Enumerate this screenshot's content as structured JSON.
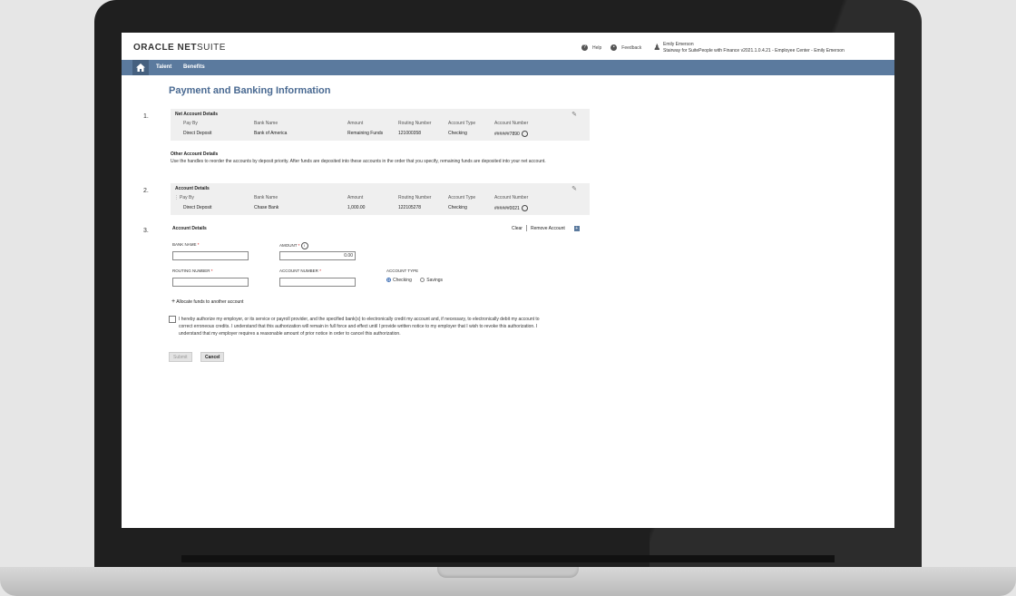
{
  "header": {
    "logo_brand": "ORACLE",
    "logo_net": "NET",
    "logo_suite": "SUITE",
    "help_label": "Help",
    "feedback_label": "Feedback",
    "user_name": "Emily Emerson",
    "user_context": "Stairway for SuitePeople with Finance v2021.1.0.4.21 - Employee Center - Emily Emerson"
  },
  "nav": {
    "items": [
      "Talent",
      "Benefits"
    ]
  },
  "page": {
    "title": "Payment and Banking Information"
  },
  "columns": [
    "Pay By",
    "Bank Name",
    "Amount",
    "Routing Number",
    "Account Type",
    "Account Number"
  ],
  "net_account": {
    "step": "1.",
    "title": "Net Account Details",
    "row": [
      "Direct Deposit",
      "Bank of America",
      "Remaining Funds",
      "121000358",
      "Checking",
      "######7890"
    ]
  },
  "other_account": {
    "title": "Other Account Details",
    "description": "Use the handles    to reorder the accounts by deposit priority. After funds are deposited into these accounts in the order that you specify, remaining funds are deposited into your net account."
  },
  "account_2": {
    "step": "2.",
    "title": "Account Details",
    "row": [
      "Direct Deposit",
      "Chase Bank",
      "1,000.00",
      "122105278",
      "Checking",
      "######0021"
    ]
  },
  "account_3": {
    "step": "3.",
    "title": "Account Details",
    "clear_label": "Clear",
    "remove_label": "Remove Account",
    "bank_name_label": "BANK NAME",
    "amount_label": "AMOUNT",
    "amount_value": "0.00",
    "routing_label": "ROUTING NUMBER",
    "account_number_label": "ACCOUNT NUMBER",
    "account_type_label": "ACCOUNT TYPE",
    "type_checking": "Checking",
    "type_savings": "Savings"
  },
  "allocate_label": "Allocate funds to another account",
  "authorization": "I hereby authorize my employer, or its service or payroll provider, and the specified bank(s) to electronically credit my account and, if necessary, to electronically debit my account to correct erroneous credits. I understand that this authorization will remain in full force and effect until I provide written notice to my employer that I wish to revoke this authorization. I understand that my employer requires a reasonable amount of prior notice in order to cancel this authorization.",
  "buttons": {
    "submit": "Submit",
    "cancel": "Cancel"
  }
}
